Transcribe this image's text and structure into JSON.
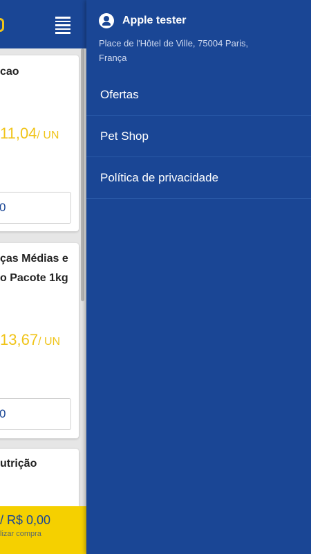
{
  "background_screen": {
    "cards": [
      {
        "title_lines": [
          "cao"
        ],
        "price": "11,04",
        "unit": "/ UN",
        "field_text": "0"
      },
      {
        "title_lines": [
          "ças Médias e",
          "o Pacote 1kg"
        ],
        "price": "13,67",
        "unit": "/ UN",
        "field_text": "0"
      },
      {
        "title_lines": [
          "utrição"
        ]
      }
    ],
    "footer": {
      "total": "/ R$ 0,00",
      "subtitle": "lizar compra"
    }
  },
  "drawer": {
    "user_name": "Apple tester",
    "address": "Place de l'Hôtel de Ville, 75004 Paris, França",
    "menu_items": [
      "Ofertas",
      "Pet Shop",
      "Política de privacidade"
    ]
  },
  "colors": {
    "primary": "#1a4695",
    "accent": "#f0c419",
    "footer": "#f5d000"
  },
  "icons": {
    "menu": "hamburger-menu-icon",
    "user": "account-circle-icon"
  }
}
